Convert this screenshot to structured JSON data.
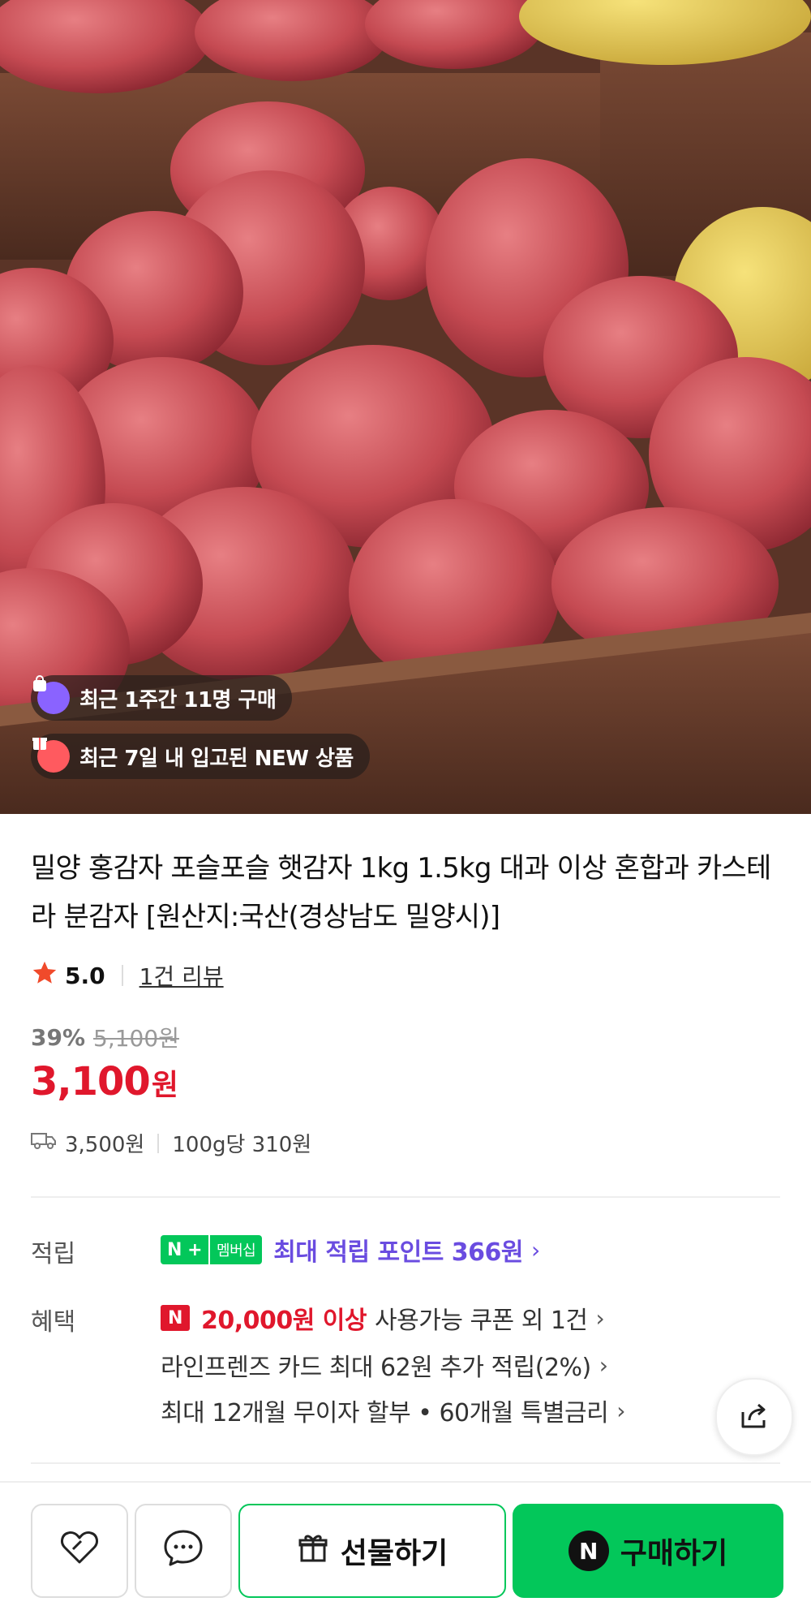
{
  "hero": {
    "badge_purchases": "최근 1주간 11명 구매",
    "badge_new": "최근 7일 내 입고된 NEW 상품"
  },
  "product": {
    "title": "밀양 홍감자 포슬포슬 햇감자 1kg 1.5kg 대과 이상 혼합과 카스테라 분감자 [원산지:국산(경상남도 밀양시)]",
    "rating": "5.0",
    "review_count": "1건 리뷰",
    "discount_rate": "39%",
    "original_price": "5,100원",
    "price": "3,100",
    "price_unit": "원",
    "shipping_fee": "3,500원",
    "unit_price": "100g당 310원"
  },
  "points": {
    "label": "적립",
    "badge_n": "N +",
    "badge_member": "멤버십",
    "text": "최대 적립 포인트 366원"
  },
  "benefits": {
    "label": "혜택",
    "coupon_badge": "N",
    "coupon_highlight": "20,000원 이상",
    "coupon_text": "사용가능 쿠폰 외 1건",
    "card_text": "라인프렌즈 카드 최대 62원 추가 적립(2%)",
    "installment_text": "최대 12개월 무이자 할부 • 60개월 특별금리"
  },
  "bottom_bar": {
    "gift_label": "선물하기",
    "buy_badge": "N",
    "buy_label": "구매하기"
  },
  "colors": {
    "accent_green": "#03c75a",
    "price_red": "#e0172c",
    "points_purple": "#6a4ce0"
  }
}
